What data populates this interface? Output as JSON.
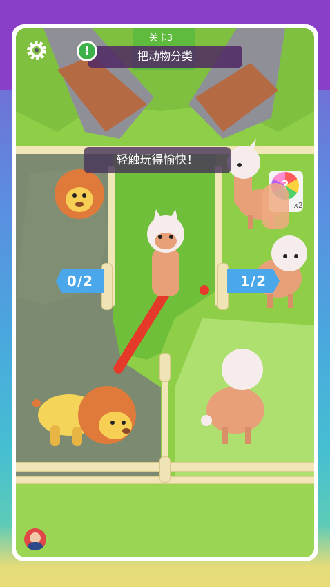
{
  "level": {
    "label": "关卡3"
  },
  "objective": {
    "text": "把动物分类"
  },
  "hint": {
    "text": "轻触玩得愉快！"
  },
  "counters": {
    "left": "0/2",
    "right": "1/2"
  },
  "powerup": {
    "multiplier": "x2"
  },
  "icons": {
    "settings": "gear-icon",
    "alert": "exclamation-icon",
    "wheel": "spin-wheel-icon",
    "finger": "tap-finger-icon",
    "avatar": "avatar-icon"
  },
  "colors": {
    "grass": "#8fcf48",
    "path": "#7c8a72",
    "counter": "#4aa8ea",
    "alert_green": "#3db04a",
    "gate": "#e53a2a"
  }
}
